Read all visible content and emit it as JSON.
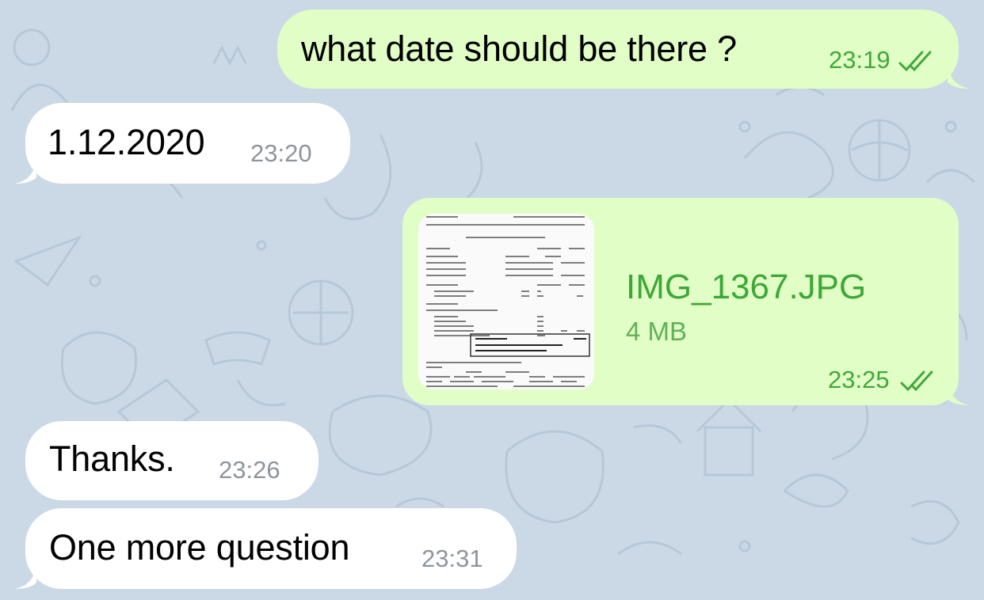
{
  "chat": {
    "messages": [
      {
        "direction": "outgoing",
        "text": "what date should be there ?",
        "time": "23:19",
        "status": "read"
      },
      {
        "direction": "incoming",
        "text": "1.12.2020",
        "time": "23:20"
      },
      {
        "direction": "outgoing",
        "type": "file",
        "file_name": "IMG_1367.JPG",
        "file_size": "4 MB",
        "time": "23:25",
        "status": "read"
      },
      {
        "direction": "incoming",
        "text": "Thanks.",
        "time": "23:26"
      },
      {
        "direction": "incoming",
        "text": "One more question",
        "time": "23:31"
      }
    ]
  },
  "colors": {
    "wallpaper": "#cbd9e6",
    "incoming_bubble": "#ffffff",
    "outgoing_bubble": "#e1fec6",
    "outgoing_time": "#42a83a",
    "incoming_time": "#8e959c",
    "file_name": "#3ea737"
  }
}
